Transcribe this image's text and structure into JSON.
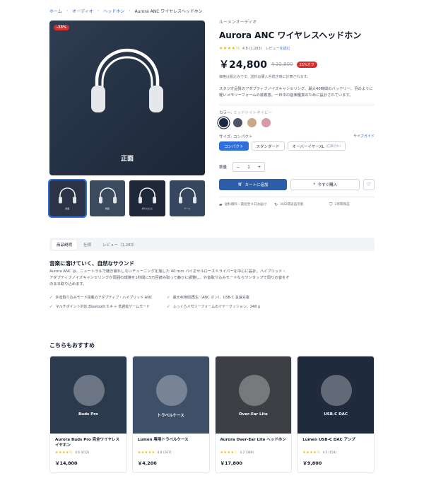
{
  "breadcrumb": {
    "items": [
      "ホーム",
      "オーディオ",
      "ヘッドホン"
    ],
    "current": "Aurora ANC ワイヤレスヘッドホン"
  },
  "gallery": {
    "discount_badge": "-23%",
    "main_view_label": "正面",
    "thumbnails": [
      "前面",
      "側面",
      "折りたたみ",
      "ケース"
    ]
  },
  "product": {
    "brand": "ルーメンオーディオ",
    "title": "Aurora ANC ワイヤレスヘッドホン",
    "stars": "★★★★½",
    "rating": "4.8 (1,283)",
    "reviews_link": "レビューを読む",
    "price": "￥24,800",
    "old_price": "￥32,900",
    "off_badge": "25%オフ",
    "tax_note": "価格は税込みです。送料は購入手続き時に計算されます。",
    "description": "スタジオ品質のアダプティブノイズキャンセリング、最大40時間のバッテリー、羽のように軽いメモリーフォームの装着感。一日中の音楽鑑賞のために設計されています。",
    "color_label": "カラー:",
    "color_value": "ミッドナイトネイビー",
    "colors": [
      "#1e2a44",
      "#4b5563",
      "#c9a98a",
      "#d99aa8"
    ],
    "size_label": "サイズ:",
    "size_value": "コンパクト",
    "size_guide": "サイズガイド",
    "sizes": [
      "コンパクト",
      "スタンダード",
      "オーバーイヤーXL"
    ],
    "size_extra": "(在庫切れ)",
    "qty_label": "数量",
    "qty_minus": "−",
    "qty_value": "1",
    "qty_plus": "+",
    "cart_label": "カートに追加",
    "buy_label": "今すぐ購入",
    "features": [
      "送料無料・最短翌々日お届け",
      "30日間返品可能",
      "2年間保証"
    ]
  },
  "tabs": [
    "商品説明",
    "仕様",
    "レビュー（1,283）"
  ],
  "details": {
    "title": "音楽に溶けていく、自然なサウンド",
    "text": "Aurora ANC は、ニュートラルで聴き疲れしないチューニングを施した 40 mm バイオセルロースドライバーを中心に設計。ハイブリッド・アダプティブノイズキャンセリングが周囲の環境を1秒間に5万回読み取って静かに調整し、外音取り込みモードならワンタップで周りの音をそのまま取り込めます。",
    "bullets": [
      "外音取り込みモード搭載のアダプティブ・ハイブリッド ANC",
      "最大40時間再生（ANC オン）、USB-C 急速充電",
      "マルチポイント対応 Bluetooth 5.4 ＋ 低遅延ゲームモード",
      "ふっくらメモリーフォームのイヤークッション、248 g"
    ]
  },
  "recommend": {
    "title": "こちらもおすすめ",
    "items": [
      {
        "img_label": "Buds Pro",
        "name": "Aurora Buds Pro 完全ワイヤレスイヤホン",
        "stars": "★★★★½",
        "rating": "4.6 (612)",
        "price": "￥14,800",
        "bg": "#2c3a4e"
      },
      {
        "img_label": "トラベルケース",
        "name": "Lumen 専用トラベルケース",
        "stars": "★★★★★",
        "rating": "4.8 (207)",
        "price": "￥4,200",
        "bg": "#3e5068"
      },
      {
        "img_label": "Over-Ear Lite",
        "name": "Aurora Over-Ear Lite ヘッドホン",
        "stars": "★★★★☆",
        "rating": "4.2 (389)",
        "price": "￥17,800",
        "bg": "#3d3f44"
      },
      {
        "img_label": "USB-C DAC",
        "name": "Lumen USB-C DAC アンプ",
        "stars": "★★★★½",
        "rating": "4.5 (154)",
        "price": "￥9,800",
        "bg": "#1f2a3d"
      }
    ]
  }
}
